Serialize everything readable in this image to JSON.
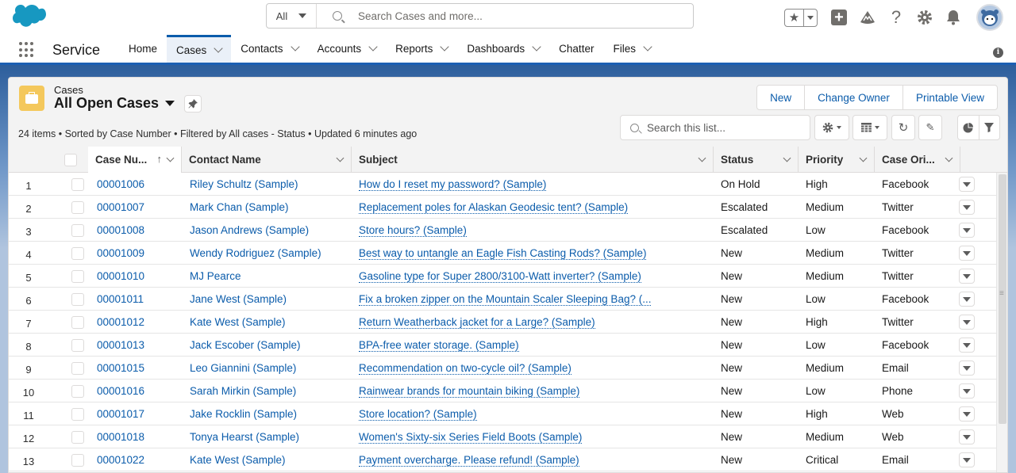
{
  "header": {
    "search_scope": "All",
    "search_placeholder": "Search Cases and more...",
    "icons": [
      "favorites-star-icon",
      "favorites-dropdown-icon",
      "global-create-icon",
      "trailhead-icon",
      "help-icon",
      "setup-gear-icon",
      "notifications-bell-icon",
      "user-avatar"
    ]
  },
  "nav": {
    "app_name": "Service",
    "items": [
      {
        "label": "Home",
        "dropdown": false,
        "active": false
      },
      {
        "label": "Cases",
        "dropdown": true,
        "active": true
      },
      {
        "label": "Contacts",
        "dropdown": true,
        "active": false
      },
      {
        "label": "Accounts",
        "dropdown": true,
        "active": false
      },
      {
        "label": "Reports",
        "dropdown": true,
        "active": false
      },
      {
        "label": "Dashboards",
        "dropdown": true,
        "active": false
      },
      {
        "label": "Chatter",
        "dropdown": false,
        "active": false
      },
      {
        "label": "Files",
        "dropdown": true,
        "active": false
      }
    ]
  },
  "list_view": {
    "object_label": "Cases",
    "title": "All Open Cases",
    "meta": "24 items • Sorted by Case Number • Filtered by All cases - Status • Updated 6 minutes ago",
    "buttons": {
      "new": "New",
      "change_owner": "Change Owner",
      "printable_view": "Printable View"
    },
    "search_placeholder": "Search this list...",
    "columns": [
      "Case Nu...",
      "Contact Name",
      "Subject",
      "Status",
      "Priority",
      "Case Ori..."
    ],
    "rows": [
      {
        "n": "1",
        "case": "00001006",
        "contact": "Riley Schultz (Sample)",
        "subject": "How do I reset my password? (Sample)",
        "status": "On Hold",
        "priority": "High",
        "origin": "Facebook"
      },
      {
        "n": "2",
        "case": "00001007",
        "contact": "Mark Chan (Sample)",
        "subject": "Replacement poles for Alaskan Geodesic tent? (Sample)",
        "status": "Escalated",
        "priority": "Medium",
        "origin": "Twitter"
      },
      {
        "n": "3",
        "case": "00001008",
        "contact": "Jason Andrews (Sample)",
        "subject": "Store hours? (Sample)",
        "status": "Escalated",
        "priority": "Low",
        "origin": "Facebook"
      },
      {
        "n": "4",
        "case": "00001009",
        "contact": "Wendy Rodriguez (Sample)",
        "subject": "Best way to untangle an Eagle Fish Casting Rods? (Sample)",
        "status": "New",
        "priority": "Medium",
        "origin": "Twitter"
      },
      {
        "n": "5",
        "case": "00001010",
        "contact": "MJ Pearce",
        "subject": "Gasoline type for Super 2800/3100-Watt inverter? (Sample)",
        "status": "New",
        "priority": "Medium",
        "origin": "Twitter"
      },
      {
        "n": "6",
        "case": "00001011",
        "contact": "Jane West (Sample)",
        "subject": "Fix a broken zipper on the Mountain Scaler Sleeping Bag? (...",
        "status": "New",
        "priority": "Low",
        "origin": "Facebook"
      },
      {
        "n": "7",
        "case": "00001012",
        "contact": "Kate West (Sample)",
        "subject": "Return Weatherback jacket for a Large? (Sample)",
        "status": "New",
        "priority": "High",
        "origin": "Twitter"
      },
      {
        "n": "8",
        "case": "00001013",
        "contact": "Jack Escober (Sample)",
        "subject": "BPA-free water storage. (Sample)",
        "status": "New",
        "priority": "Low",
        "origin": "Facebook"
      },
      {
        "n": "9",
        "case": "00001015",
        "contact": "Leo Giannini (Sample)",
        "subject": "Recommendation on two-cycle oil? (Sample)",
        "status": "New",
        "priority": "Medium",
        "origin": "Email"
      },
      {
        "n": "10",
        "case": "00001016",
        "contact": "Sarah Mirkin (Sample)",
        "subject": "Rainwear brands for mountain biking (Sample)",
        "status": "New",
        "priority": "Low",
        "origin": "Phone"
      },
      {
        "n": "11",
        "case": "00001017",
        "contact": "Jake Rocklin (Sample)",
        "subject": "Store location? (Sample)",
        "status": "New",
        "priority": "High",
        "origin": "Web"
      },
      {
        "n": "12",
        "case": "00001018",
        "contact": "Tonya Hearst (Sample)",
        "subject": "Women's Sixty-six Series Field Boots (Sample)",
        "status": "New",
        "priority": "Medium",
        "origin": "Web"
      },
      {
        "n": "13",
        "case": "00001022",
        "contact": "Kate West (Sample)",
        "subject": "Payment overcharge. Please refund! (Sample)",
        "status": "New",
        "priority": "Critical",
        "origin": "Email"
      }
    ]
  },
  "colors": {
    "brand_blue": "#0b5cab",
    "case_icon": "#f4c85c",
    "logo": "#1798c1"
  }
}
